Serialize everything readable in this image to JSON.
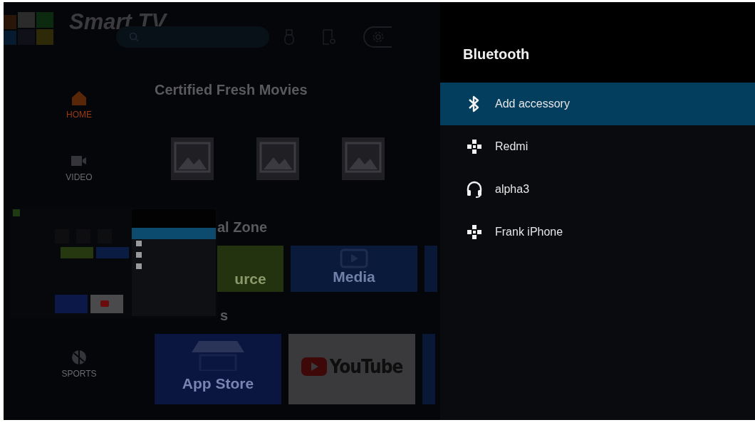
{
  "home": {
    "brand": "Smart TV",
    "sidebar": [
      {
        "label": "HOME",
        "kind": "home",
        "selected": true
      },
      {
        "label": "VIDEO",
        "kind": "video",
        "selected": false
      },
      {
        "label": "SPORTS",
        "kind": "sports",
        "selected": false
      }
    ],
    "sections": [
      {
        "title": "Certified Fresh Movies",
        "kind": "posters"
      },
      {
        "title": "al Zone",
        "kind": "tiles",
        "tiles": [
          {
            "label": "urce",
            "kind": "source"
          },
          {
            "label": "Media",
            "kind": "media"
          },
          {
            "kind": "partial"
          }
        ]
      },
      {
        "title": "s",
        "kind": "apps",
        "tiles": [
          {
            "label": "App Store",
            "kind": "store"
          },
          {
            "label": "YouTube",
            "kind": "youtube"
          },
          {
            "kind": "partial"
          }
        ]
      }
    ]
  },
  "panel": {
    "title": "Bluetooth",
    "items": [
      {
        "label": "Add accessory",
        "kind": "bluetooth",
        "selected": true
      },
      {
        "label": "Redmi",
        "kind": "gamepad",
        "selected": false
      },
      {
        "label": "alpha3",
        "kind": "headset",
        "selected": false
      },
      {
        "label": "Frank iPhone",
        "kind": "gamepad",
        "selected": false
      }
    ]
  }
}
